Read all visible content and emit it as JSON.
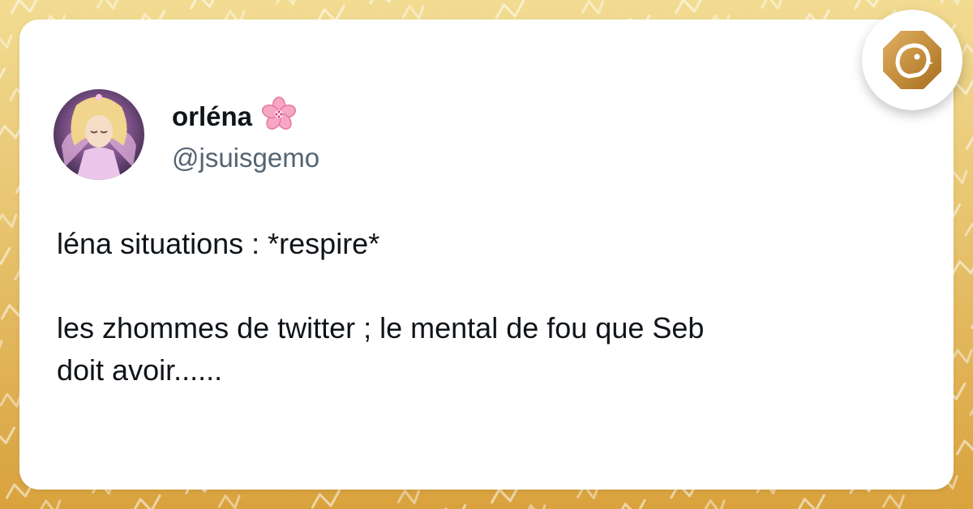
{
  "colors": {
    "background_top": "#f2dc92",
    "background_bottom": "#d9a23d",
    "card": "#ffffff",
    "name_text": "#0f1419",
    "handle_text": "#536471",
    "brand_gold": "#c38a2f"
  },
  "tweet": {
    "display_name": "orléna",
    "name_emoji": "cherry-blossom-icon",
    "handle": "@jsuisgemo",
    "avatar": "avatar-image",
    "lines": [
      "léna situations : *respire*",
      "",
      "les zhommes de twitter ; le mental de fou que Seb",
      "doit avoir......"
    ]
  },
  "brand_badge": {
    "icon": "brand-logo-icon"
  }
}
